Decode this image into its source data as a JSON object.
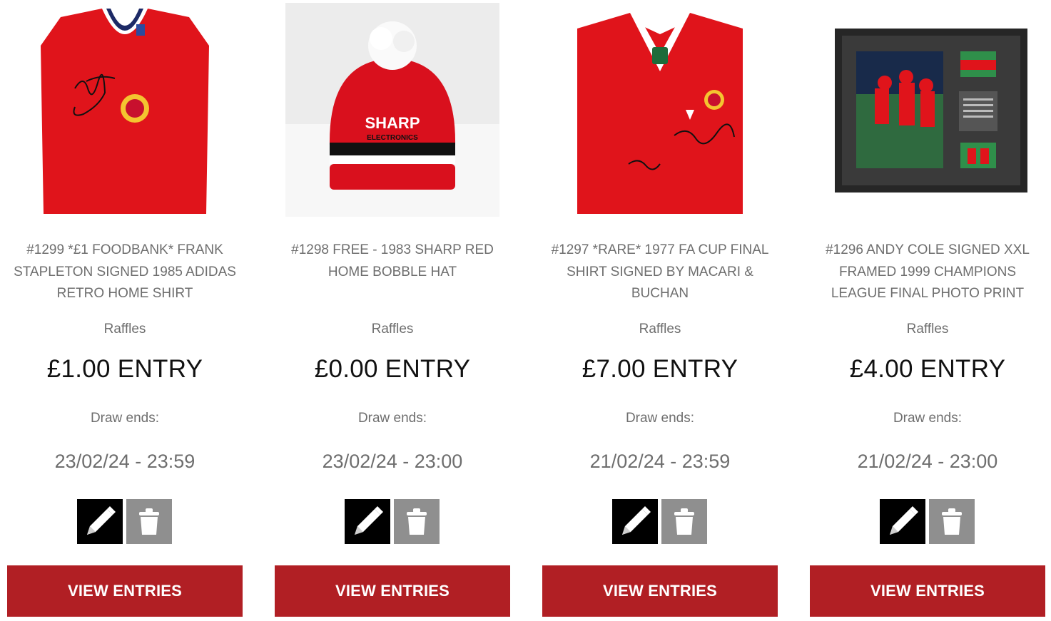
{
  "cards": [
    {
      "title": "#1299 *£1 FOODBANK* FRANK STAPLETON SIGNED 1985 ADIDAS RETRO HOME SHIRT",
      "category": "Raffles",
      "price": "£1.00 ENTRY",
      "draw_label": "Draw ends:",
      "draw_date": "23/02/24 - 23:59",
      "view_label": "VIEW ENTRIES",
      "image": "signed-red-adidas-retro-shirt"
    },
    {
      "title": "#1298 FREE - 1983 SHARP RED HOME BOBBLE HAT",
      "category": "Raffles",
      "price": "£0.00 ENTRY",
      "draw_label": "Draw ends:",
      "draw_date": "23/02/24 - 23:00",
      "view_label": "VIEW ENTRIES",
      "image": "red-sharp-bobble-hat",
      "image_text": [
        "SHARP",
        "ELECTRONICS"
      ]
    },
    {
      "title": "#1297 *RARE* 1977 FA CUP FINAL SHIRT SIGNED BY MACARI & BUCHAN",
      "category": "Raffles",
      "price": "£7.00 ENTRY",
      "draw_label": "Draw ends:",
      "draw_date": "21/02/24 - 23:59",
      "view_label": "VIEW ENTRIES",
      "image": "signed-1977-fa-cup-final-shirt"
    },
    {
      "title": "#1296 ANDY COLE SIGNED XXL FRAMED 1999 CHAMPIONS LEAGUE FINAL PHOTO PRINT",
      "category": "Raffles",
      "price": "£4.00 ENTRY",
      "draw_label": "Draw ends:",
      "draw_date": "21/02/24 - 23:00",
      "view_label": "VIEW ENTRIES",
      "image": "framed-champions-league-photo"
    }
  ],
  "icons": {
    "edit": "pencil-icon",
    "delete": "trash-icon"
  },
  "colors": {
    "accent": "#b11f24",
    "shirt_red": "#e0141b",
    "edit_bg": "#000000",
    "delete_bg": "#8f8f8f",
    "muted_text": "#6e6e6e",
    "price_text": "#111111"
  }
}
